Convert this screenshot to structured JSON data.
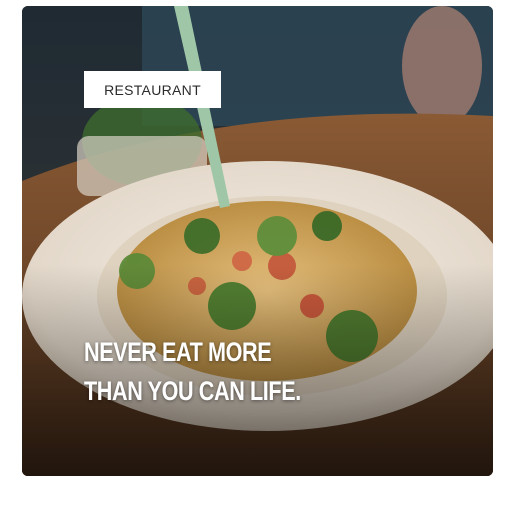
{
  "card": {
    "category_label": "RESTAURANT",
    "headline_lines": [
      "NEVER EAT MORE",
      "THAN YOU CAN LIFE."
    ],
    "image_icon": "pasta-dish-photo"
  },
  "colors": {
    "tag_bg": "#ffffff",
    "tag_text": "#2b2b2b",
    "headline_text": "#ffffff"
  }
}
